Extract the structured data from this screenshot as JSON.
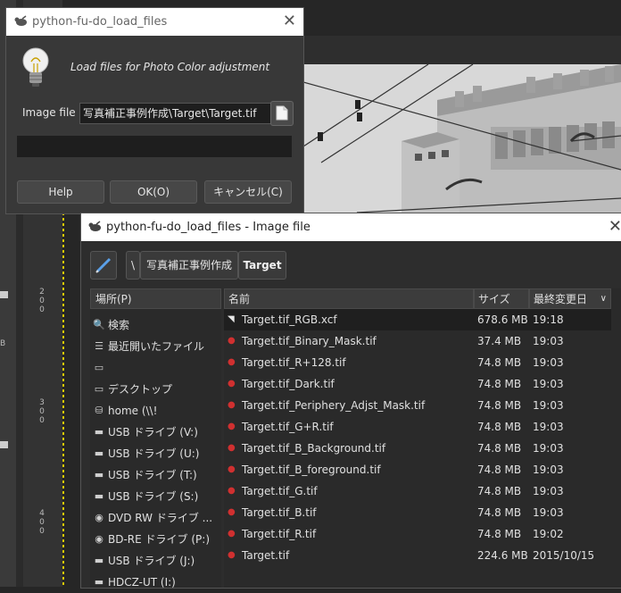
{
  "background": {
    "ruler_numbers": [
      "2",
      "0",
      "0",
      "3",
      "0",
      "0",
      "4",
      "0",
      "0"
    ],
    "sidebar_letter": "B"
  },
  "dialog_small": {
    "title": "python-fu-do_load_files",
    "description": "Load files for Photo Color adjustment",
    "image_file_label": "Image file",
    "image_file_value": "写真補正事例作成\\Target\\Target.tif",
    "buttons": {
      "help": "Help",
      "ok": "OK(O)",
      "cancel": "キャンセル(C)"
    }
  },
  "dialog_file": {
    "title": "python-fu-do_load_files - Image file",
    "path": {
      "root": "\\",
      "parent": "写真補正事例作成",
      "current": "Target"
    },
    "places_header": "場所(P)",
    "places": [
      {
        "icon": "search-icon",
        "label": "検索"
      },
      {
        "icon": "recent-icon",
        "label": "最近開いたファイル"
      },
      {
        "icon": "folder-icon",
        "label": ""
      },
      {
        "icon": "folder-icon",
        "label": "デスクトップ"
      },
      {
        "icon": "network-drive-icon",
        "label": "home (\\\\!"
      },
      {
        "icon": "drive-icon",
        "label": "USB ドライブ (V:)"
      },
      {
        "icon": "drive-icon",
        "label": "USB ドライブ (U:)"
      },
      {
        "icon": "drive-icon",
        "label": "USB ドライブ (T:)"
      },
      {
        "icon": "drive-icon",
        "label": "USB ドライブ (S:)"
      },
      {
        "icon": "optical-drive-icon",
        "label": "DVD RW ドライブ ..."
      },
      {
        "icon": "optical-drive-icon",
        "label": "BD-RE ドライブ (P:)"
      },
      {
        "icon": "drive-icon",
        "label": "USB ドライブ (J:)"
      },
      {
        "icon": "drive-icon",
        "label": "HDCZ-UT (I:)"
      }
    ],
    "columns": {
      "name": "名前",
      "size": "サイズ",
      "modified": "最終変更日"
    },
    "files": [
      {
        "name": "Target.tif_RGB.xcf",
        "size": "678.6 MB",
        "modified": "19:18",
        "icon": "xcf-file-icon",
        "selected": true
      },
      {
        "name": "Target.tif_Binary_Mask.tif",
        "size": "37.4 MB",
        "modified": "19:03",
        "icon": "image-file-icon"
      },
      {
        "name": "Target.tif_R+128.tif",
        "size": "74.8 MB",
        "modified": "19:03",
        "icon": "image-file-icon"
      },
      {
        "name": "Target.tif_Dark.tif",
        "size": "74.8 MB",
        "modified": "19:03",
        "icon": "image-file-icon"
      },
      {
        "name": "Target.tif_Periphery_Adjst_Mask.tif",
        "size": "74.8 MB",
        "modified": "19:03",
        "icon": "image-file-icon"
      },
      {
        "name": "Target.tif_G+R.tif",
        "size": "74.8 MB",
        "modified": "19:03",
        "icon": "image-file-icon"
      },
      {
        "name": "Target.tif_B_Background.tif",
        "size": "74.8 MB",
        "modified": "19:03",
        "icon": "image-file-icon"
      },
      {
        "name": "Target.tif_B_foreground.tif",
        "size": "74.8 MB",
        "modified": "19:03",
        "icon": "image-file-icon"
      },
      {
        "name": "Target.tif_G.tif",
        "size": "74.8 MB",
        "modified": "19:03",
        "icon": "image-file-icon"
      },
      {
        "name": "Target.tif_B.tif",
        "size": "74.8 MB",
        "modified": "19:03",
        "icon": "image-file-icon"
      },
      {
        "name": "Target.tif_R.tif",
        "size": "74.8 MB",
        "modified": "19:02",
        "icon": "image-file-icon"
      },
      {
        "name": "Target.tif",
        "size": "224.6 MB",
        "modified": "2015/10/15",
        "icon": "image-file-icon"
      }
    ]
  }
}
